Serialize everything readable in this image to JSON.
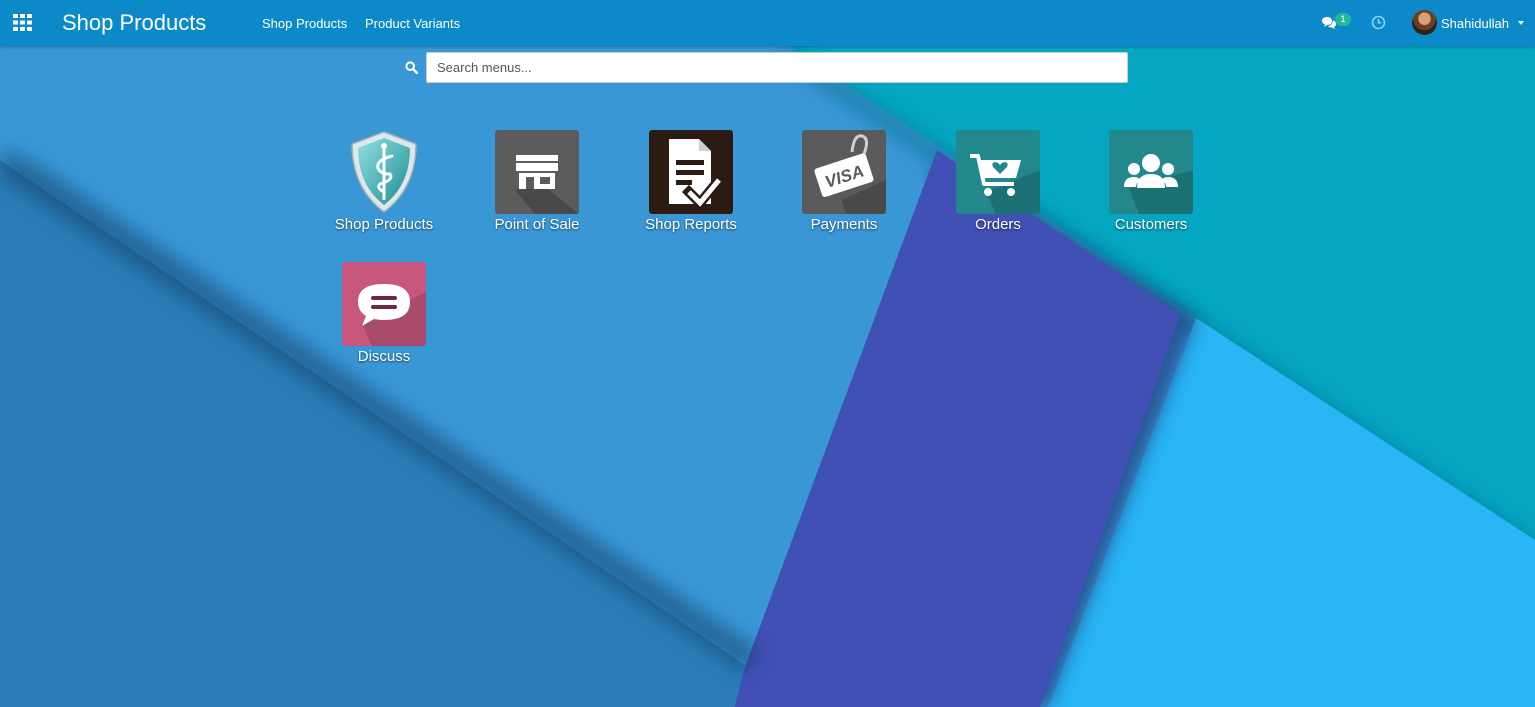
{
  "header": {
    "brand": "Shop Products",
    "menus": [
      {
        "label": "Shop Products"
      },
      {
        "label": "Product Variants"
      }
    ],
    "chat_count": "1",
    "user_name": "Shahidullah"
  },
  "search": {
    "placeholder": "Search menus..."
  },
  "apps": [
    {
      "label": "Shop Products",
      "icon": "shield-caduceus-icon"
    },
    {
      "label": "Point of Sale",
      "icon": "storefront-icon"
    },
    {
      "label": "Shop Reports",
      "icon": "document-check-icon"
    },
    {
      "label": "Payments",
      "icon": "visa-card-icon"
    },
    {
      "label": "Orders",
      "icon": "shopping-cart-icon"
    },
    {
      "label": "Customers",
      "icon": "users-icon"
    },
    {
      "label": "Discuss",
      "icon": "chat-bubble-icon"
    }
  ],
  "colors": {
    "navbar": "#0b89c8",
    "badge": "#21b799",
    "background_base": "#3a97d6",
    "background_teal": "#06aac4",
    "background_indigo": "#3f51b5",
    "background_sky": "#29b6f6"
  }
}
